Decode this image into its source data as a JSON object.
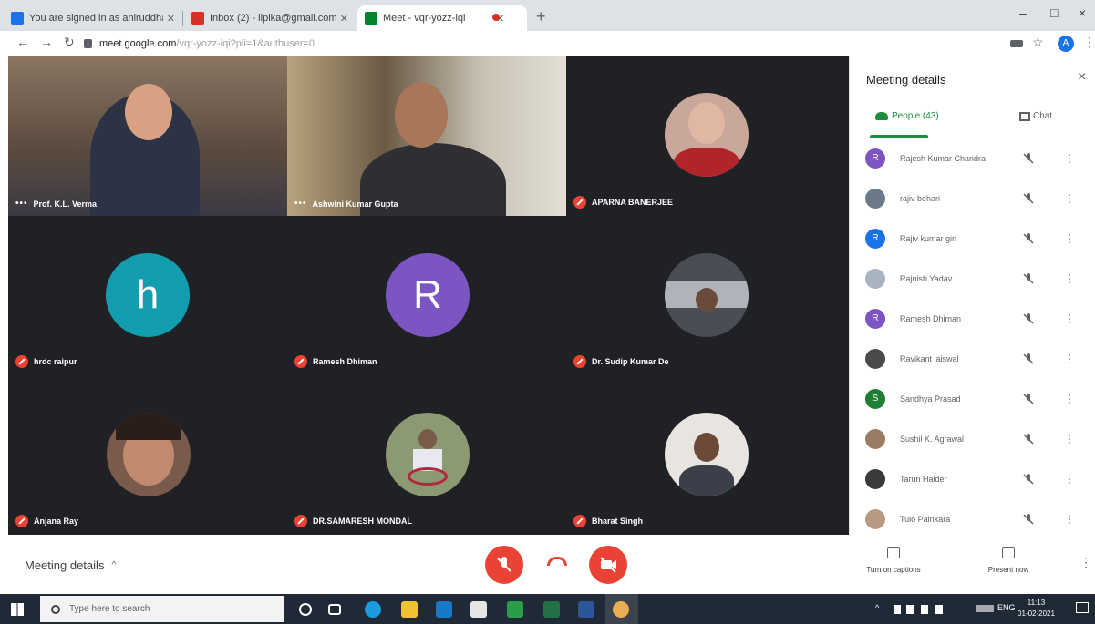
{
  "browser": {
    "tabs": [
      {
        "title": "You are signed in as aniruddha@...",
        "favicon_color": "#1a73e8"
      },
      {
        "title": "Inbox (2) - lipika@gmail.com",
        "favicon_color": "#d93025"
      },
      {
        "title": "Meet - vqr-yozz-iqi",
        "favicon_color": "#00832d"
      }
    ],
    "new_tab": "+",
    "window_controls": [
      "–",
      "□",
      "×"
    ],
    "url_host": "meet.google.com",
    "url_path": "/vqr-yozz-iqi?pli=1&authuser=0",
    "profile_initial": "A"
  },
  "tiles": [
    {
      "name": "Prof. K.L. Verma",
      "type": "video1",
      "dots": "•••"
    },
    {
      "name": "Ashwini Kumar Gupta",
      "type": "video2",
      "dots": "•••"
    },
    {
      "name": "APARNA BANERJEE",
      "type": "photo",
      "photo_color": "#c9a79a"
    },
    {
      "name": "hrdc raipur",
      "type": "letter",
      "letter": "h",
      "color": "#129eaf"
    },
    {
      "name": "Ramesh Dhiman",
      "type": "letter",
      "letter": "R",
      "color": "#7b55c2"
    },
    {
      "name": "Dr. Sudip Kumar De",
      "type": "photo",
      "photo_color": "#4a4e54"
    },
    {
      "name": "Anjana Ray",
      "type": "photo",
      "photo_color": "#7a5a4c"
    },
    {
      "name": "DR.SAMARESH MONDAL",
      "type": "photo",
      "photo_color": "#8c9a74"
    },
    {
      "name": "Bharat Singh",
      "type": "photo",
      "photo_color": "#e8e4df"
    }
  ],
  "panel": {
    "title": "Meeting details",
    "close": "×",
    "people_tab": "People (43)",
    "chat_tab": "Chat",
    "people": [
      {
        "name": "Rajesh Kumar Chandra",
        "initial": "R",
        "color": "#7b55c2",
        "photo": false
      },
      {
        "name": "rajiv behari",
        "initial": "",
        "color": "#6b7a8a",
        "photo": true
      },
      {
        "name": "Rajiv kumar giri",
        "initial": "R",
        "color": "#1a73e8",
        "photo": false
      },
      {
        "name": "Rajnish Yadav",
        "initial": "",
        "color": "#a8b4c2",
        "photo": true
      },
      {
        "name": "Ramesh Dhiman",
        "initial": "R",
        "color": "#7b55c2",
        "photo": false
      },
      {
        "name": "Ravikant jaiswal",
        "initial": "",
        "color": "#4a4a4a",
        "photo": true
      },
      {
        "name": "Sandhya Prasad",
        "initial": "S",
        "color": "#1e7e34",
        "photo": false
      },
      {
        "name": "Sushil K. Agrawal",
        "initial": "",
        "color": "#9a7c62",
        "photo": true
      },
      {
        "name": "Tarun Halder",
        "initial": "",
        "color": "#3a3a3a",
        "photo": true
      },
      {
        "name": "Tulo Painkara",
        "initial": "",
        "color": "#b89a82",
        "photo": true
      }
    ]
  },
  "bottom": {
    "meeting_details": "Meeting details",
    "chevron": "^",
    "captions_label": "Turn on captions",
    "present_label": "Present now",
    "more": "⋮"
  },
  "taskbar": {
    "search_placeholder": "Type here to search",
    "lang": "ENG",
    "time": "11:13",
    "date": "01-02-2021"
  }
}
